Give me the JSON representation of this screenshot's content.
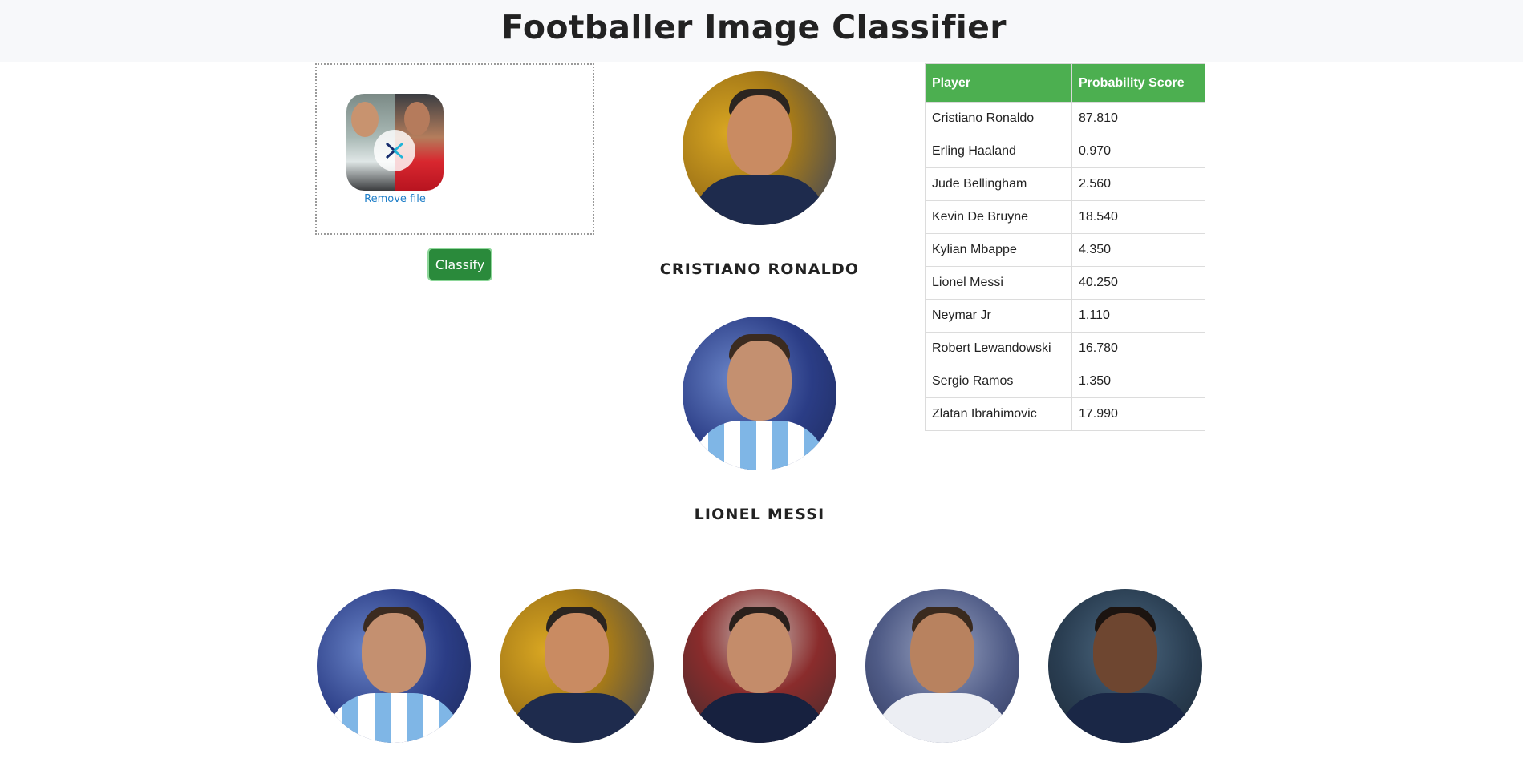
{
  "page": {
    "title": "Footballer Image Classifier"
  },
  "upload": {
    "remove_label": "Remove file",
    "thumbnail_icon": "uploaded-image-thumbnail",
    "remove_icon": "close-x-icon"
  },
  "classify_label": "Classify",
  "results": [
    {
      "name": "CRISTIANO RONALDO",
      "photo": "ronaldo-portrait"
    },
    {
      "name": "LIONEL MESSI",
      "photo": "messi-portrait"
    }
  ],
  "table": {
    "headers": [
      "Player",
      "Probability Score"
    ],
    "rows": [
      [
        "Cristiano Ronaldo",
        "87.810"
      ],
      [
        "Erling Haaland",
        "0.970"
      ],
      [
        "Jude Bellingham",
        "2.560"
      ],
      [
        "Kevin De Bruyne",
        "18.540"
      ],
      [
        "Kylian Mbappe",
        "4.350"
      ],
      [
        "Lionel Messi",
        "40.250"
      ],
      [
        "Neymar Jr",
        "1.110"
      ],
      [
        "Robert Lewandowski",
        "16.780"
      ],
      [
        "Sergio Ramos",
        "1.350"
      ],
      [
        "Zlatan Ibrahimovic",
        "17.990"
      ]
    ]
  },
  "gallery": [
    "messi-portrait",
    "ronaldo-portrait",
    "ibrahimovic-portrait",
    "neymar-portrait",
    "mbappe-portrait"
  ],
  "colors": {
    "header_bg": "#f7f8fa",
    "table_header": "#4caf50",
    "button": "#2a8a3b",
    "link": "#1e7ec8"
  }
}
